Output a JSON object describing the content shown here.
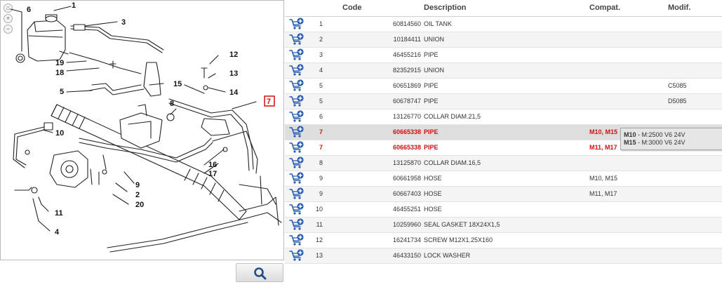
{
  "table": {
    "headers": {
      "code": "Code",
      "description": "Description",
      "compat": "Compat.",
      "modif": "Modif."
    },
    "rows": [
      {
        "pos": "1",
        "code": "60814560",
        "desc": "OIL TANK",
        "compat": "",
        "modif": ""
      },
      {
        "pos": "2",
        "code": "10184411",
        "desc": "UNION",
        "compat": "",
        "modif": ""
      },
      {
        "pos": "3",
        "code": "46455216",
        "desc": "PIPE",
        "compat": "",
        "modif": ""
      },
      {
        "pos": "4",
        "code": "82352915",
        "desc": "UNION",
        "compat": "",
        "modif": ""
      },
      {
        "pos": "5",
        "code": "60651869",
        "desc": "PIPE",
        "compat": "",
        "modif": "C5085"
      },
      {
        "pos": "5",
        "code": "60678747",
        "desc": "PIPE",
        "compat": "",
        "modif": "D5085"
      },
      {
        "pos": "6",
        "code": "13126770",
        "desc": "COLLAR DIAM.21,5",
        "compat": "",
        "modif": ""
      },
      {
        "pos": "7",
        "code": "60665338",
        "desc": "PIPE",
        "compat": "M10, M15",
        "modif": ""
      },
      {
        "pos": "7",
        "code": "60665338",
        "desc": "PIPE",
        "compat": "M11, M17",
        "modif": ""
      },
      {
        "pos": "8",
        "code": "13125870",
        "desc": "COLLAR DIAM.16,5",
        "compat": "",
        "modif": ""
      },
      {
        "pos": "9",
        "code": "60661958",
        "desc": "HOSE",
        "compat": "M10, M15",
        "modif": ""
      },
      {
        "pos": "9",
        "code": "60667403",
        "desc": "HOSE",
        "compat": "M11, M17",
        "modif": ""
      },
      {
        "pos": "10",
        "code": "46455251",
        "desc": "HOSE",
        "compat": "",
        "modif": ""
      },
      {
        "pos": "11",
        "code": "10259960",
        "desc": "SEAL GASKET 18X24X1,5",
        "compat": "",
        "modif": ""
      },
      {
        "pos": "12",
        "code": "16241734",
        "desc": "SCREW M12X1.25X160",
        "compat": "",
        "modif": ""
      },
      {
        "pos": "13",
        "code": "46433150",
        "desc": "LOCK WASHER",
        "compat": "",
        "modif": ""
      }
    ]
  },
  "tooltip": {
    "line1_code": "M10",
    "line1_text": " - M:2500 V6 24V",
    "line2_code": "M15",
    "line2_text": " - M:3000 V6 24V"
  },
  "diagram": {
    "callouts": [
      "1",
      "2",
      "3",
      "4",
      "5",
      "6",
      "7",
      "8",
      "9",
      "10",
      "11",
      "12",
      "13",
      "14",
      "15",
      "16",
      "17",
      "18",
      "19",
      "20"
    ],
    "zoom": {
      "home": "⌂",
      "in": "+",
      "out": "−"
    }
  },
  "icons": {
    "cart": "cart-add-icon",
    "search": "search-icon"
  },
  "colors": {
    "highlight": "#d01010",
    "cart": "#2a5db0",
    "hover_row": "#dedede"
  }
}
